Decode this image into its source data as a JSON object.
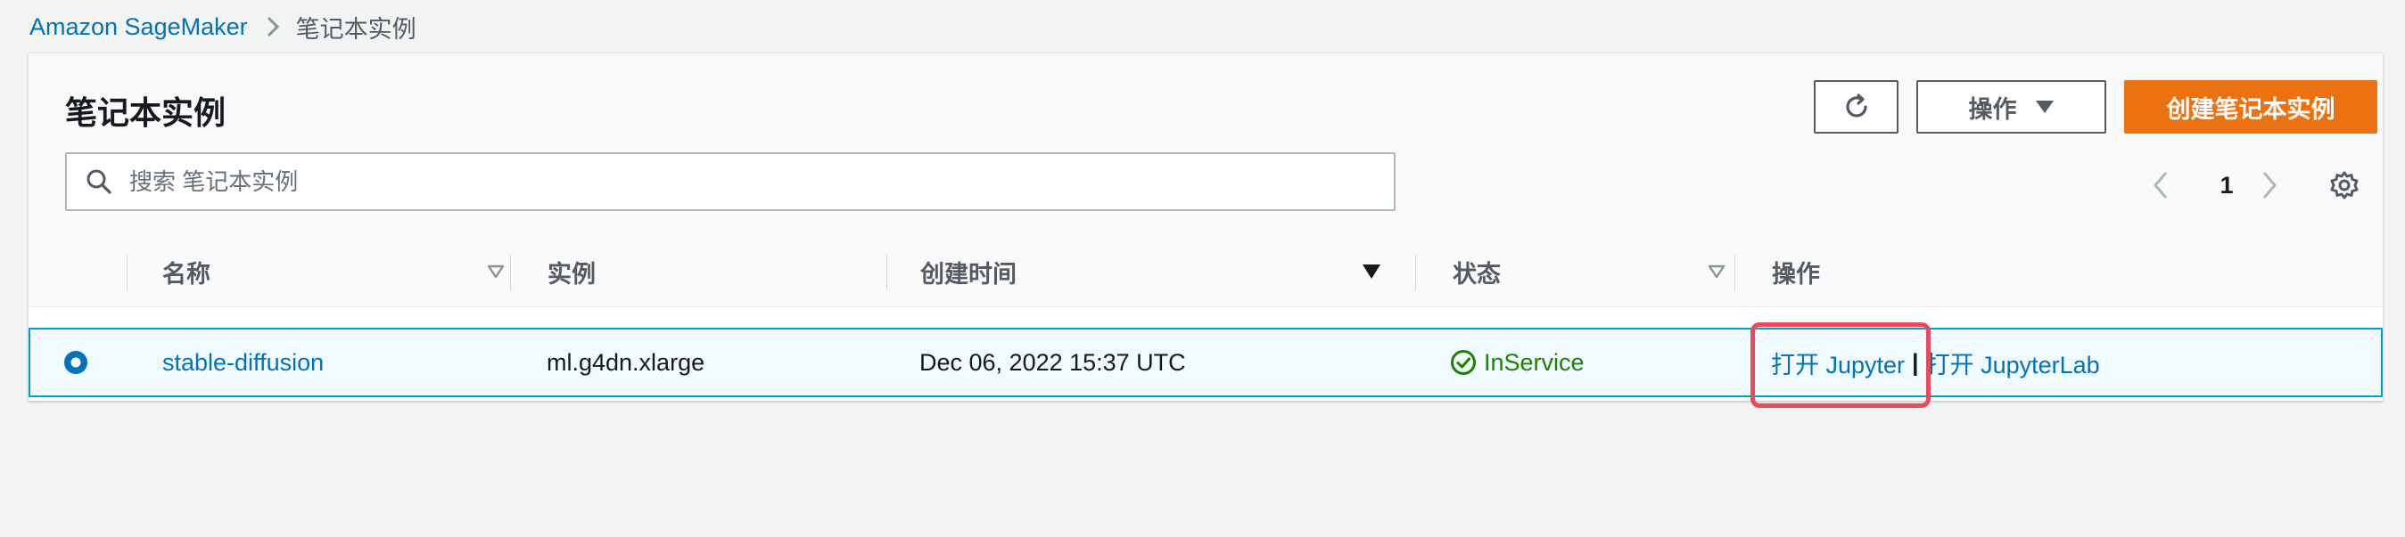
{
  "breadcrumb": {
    "root": "Amazon SageMaker",
    "current": "笔记本实例"
  },
  "header": {
    "title": "笔记本实例",
    "actions_label": "操作",
    "create_label": "创建笔记本实例"
  },
  "search": {
    "placeholder": "搜索 笔记本实例",
    "value": ""
  },
  "pagination": {
    "current_page": "1"
  },
  "table": {
    "columns": [
      "名称",
      "实例",
      "创建时间",
      "状态",
      "操作"
    ],
    "rows": [
      {
        "selected": true,
        "name": "stable-diffusion",
        "instance": "ml.g4dn.xlarge",
        "created": "Dec 06, 2022 15:37 UTC",
        "status": "InService",
        "action_jupyter": "打开 Jupyter",
        "action_separator": "|",
        "action_jupyterlab": "打开 JupyterLab"
      }
    ]
  },
  "colors": {
    "link": "#0073bb",
    "primary": "#ec7211",
    "success": "#1d8102",
    "selected_border": "#00a1c9",
    "highlight": "#ea4a5a"
  }
}
